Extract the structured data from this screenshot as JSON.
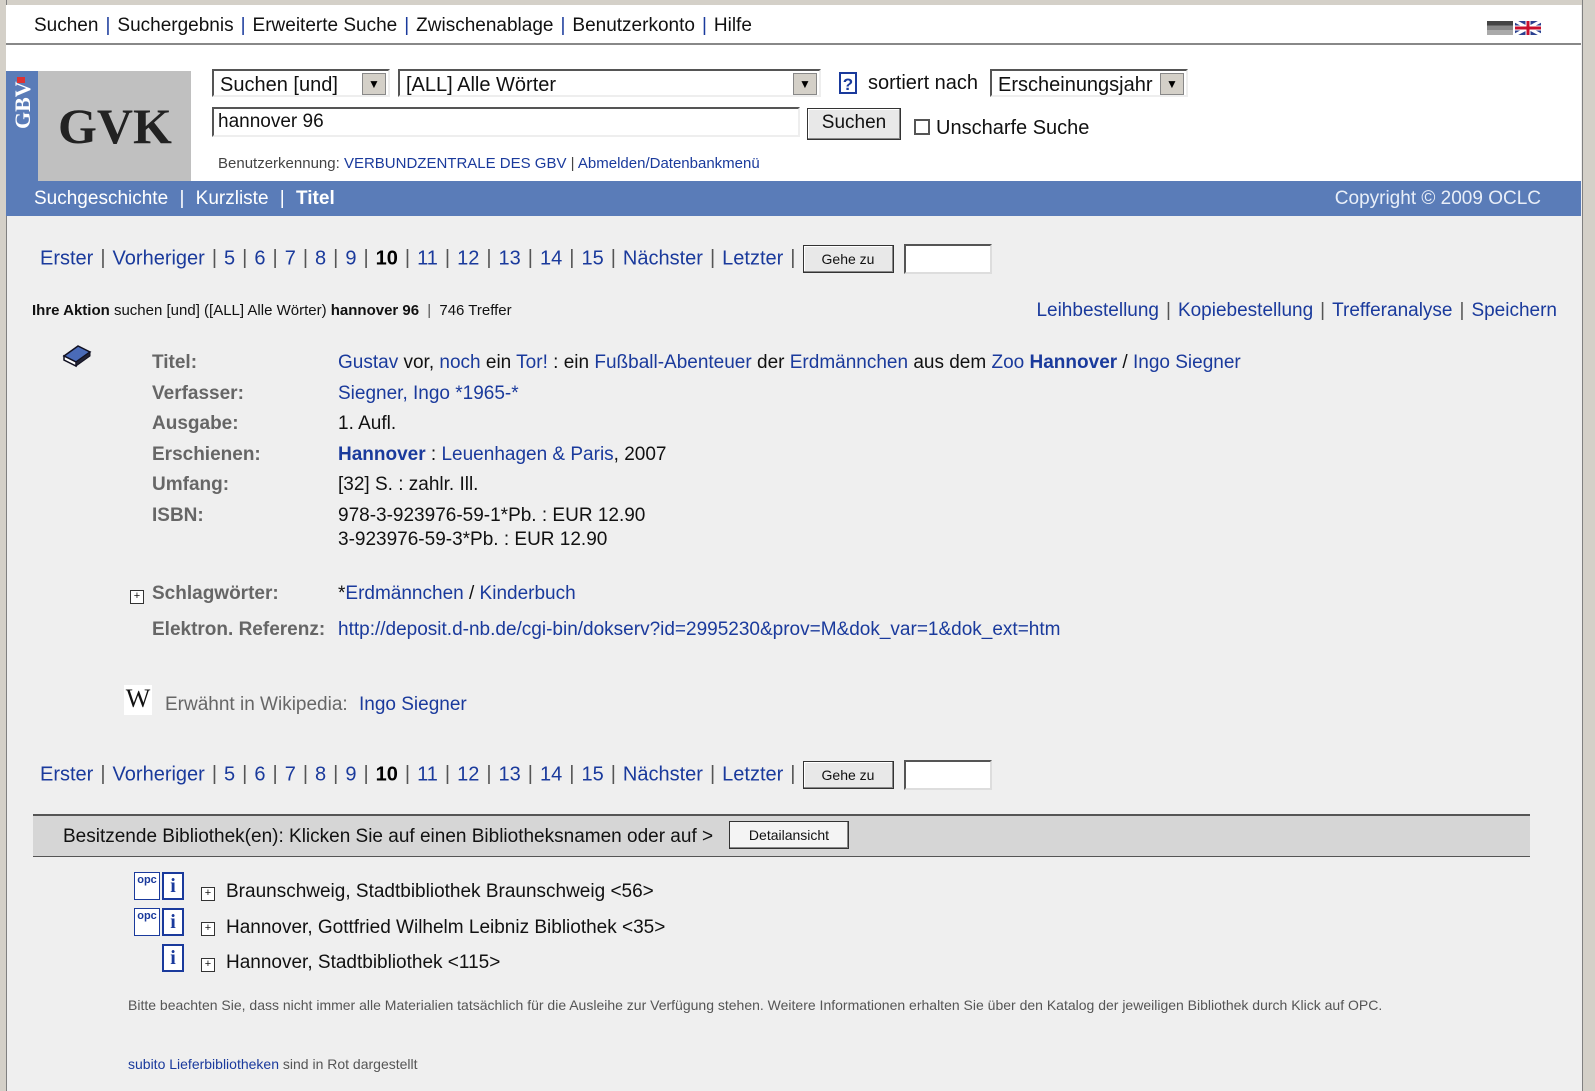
{
  "top_menu": {
    "items": [
      "Suchen",
      "Suchergebnis",
      "Erweiterte Suche",
      "Zwischenablage",
      "Benutzerkonto",
      "Hilfe"
    ]
  },
  "header": {
    "gbv_label": "GBV",
    "logo_text": "GVK",
    "search_mode": "Suchen [und]",
    "search_index": "[ALL] Alle Wörter",
    "help_glyph": "?",
    "sort_label": "sortiert nach",
    "sort_value": "Erscheinungsjahr",
    "query_value": "hannover 96",
    "search_button": "Suchen",
    "fuzzy_label": "Unscharfe Suche",
    "user_label": "Benutzerkennung:",
    "user_name": "VERBUNDZENTRALE DES GBV",
    "logout_link": "Abmelden/Datenbankmenü"
  },
  "bluebar": {
    "history": "Suchgeschichte",
    "shortlist": "Kurzliste",
    "title": "Titel",
    "copyright": "Copyright © 2009 OCLC"
  },
  "pager": {
    "first": "Erster",
    "prev": "Vorheriger",
    "pages": [
      "5",
      "6",
      "7",
      "8",
      "9"
    ],
    "current": "10",
    "pages_after": [
      "11",
      "12",
      "13",
      "14",
      "15"
    ],
    "next": "Nächster",
    "last": "Letzter",
    "goto": "Gehe zu"
  },
  "action": {
    "label": "Ihre Aktion",
    "text": "suchen [und] ([ALL] Alle Wörter)",
    "query": "hannover 96",
    "hits": "746 Treffer",
    "links": [
      "Leihbestellung",
      "Kopiebestellung",
      "Trefferanalyse",
      "Speichern"
    ]
  },
  "record": {
    "title_label": "Titel:",
    "title_parts": {
      "w1": "Gustav",
      "t1": " vor, ",
      "w2": "noch",
      "t2": " ein ",
      "w3": "Tor!",
      "t3": " : ein ",
      "w4": "Fußball-Abenteuer",
      "t4": " der ",
      "w5": "Erdmännchen",
      "t5": " aus dem ",
      "w6": "Zoo",
      "t6": " ",
      "w7": "Hannover",
      "t7": " / ",
      "w8": "Ingo Siegner"
    },
    "author_label": "Verfasser:",
    "author": "Siegner, Ingo *1965-*",
    "edition_label": "Ausgabe:",
    "edition": "1. Aufl.",
    "published_label": "Erschienen:",
    "published_place": "Hannover",
    "published_sep": " : ",
    "published_publisher": "Leuenhagen & Paris",
    "published_year": ", 2007",
    "extent_label": "Umfang:",
    "extent": "[32] S. : zahlr. Ill.",
    "isbn_label": "ISBN:",
    "isbn1": "978-3-923976-59-1*Pb. : EUR 12.90",
    "isbn2": "3-923976-59-3*Pb. : EUR 12.90",
    "subjects_label": "Schlagwörter:",
    "subject_prefix": "*",
    "subject1": "Erdmännchen",
    "subject_sep": " / ",
    "subject2": "Kinderbuch",
    "eref_label": "Elektron. Referenz:",
    "eref": "http://deposit.d-nb.de/cgi-bin/dokserv?id=2995230&prov=M&dok_var=1&dok_ext=htm",
    "wiki_glyph": "W",
    "wiki_label": "Erwähnt in Wikipedia:",
    "wiki_link": "Ingo Siegner"
  },
  "holdings": {
    "bar_text": "Besitzende Bibliothek(en): Klicken Sie auf einen Bibliotheksnamen oder auf >",
    "detail_button": "Detailansicht",
    "opc_glyph": "opc",
    "info_glyph": "i",
    "libraries": [
      "Braunschweig, Stadtbibliothek Braunschweig <56>",
      "Hannover, Gottfried Wilhelm Leibniz Bibliothek <35>",
      "Hannover, Stadtbibliothek <115>"
    ],
    "note": "Bitte beachten Sie, dass nicht immer alle Materialien tatsächlich für die Ausleihe zur Verfügung stehen. Weitere Informationen erhalten Sie über den Katalog der jeweiligen Bibliothek durch Klick auf OPC.",
    "subito_link": "subito Lieferbibliotheken",
    "subito_text": " sind in Rot dargestellt"
  },
  "icons": {
    "book": "book-icon",
    "expand": "plus-box-icon",
    "wikipedia": "wikipedia-icon",
    "opc": "opc-icon",
    "info": "info-icon",
    "flag_de": "german-flag-icon",
    "flag_uk": "uk-flag-icon"
  },
  "colors": {
    "link": "#1a3a9c",
    "bar": "#5a7cb8",
    "background": "#efefef"
  }
}
